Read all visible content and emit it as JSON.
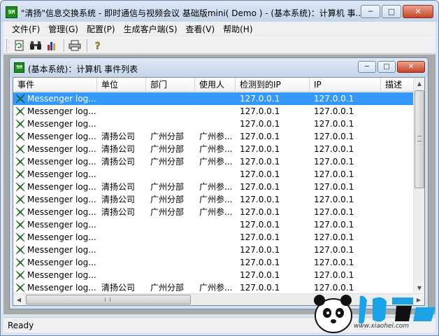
{
  "window": {
    "title": "\"清扬\"信息交换系统 - 即时通信与视频会议 基础版mini( Demo ) - (基本系统)：计算机 事...",
    "app_icon_text": "9M",
    "minimize": "─",
    "maximize": "□",
    "close": "✕"
  },
  "menu": {
    "items": [
      {
        "label": "文件(F)"
      },
      {
        "label": "管理(G)"
      },
      {
        "label": "配置(P)"
      },
      {
        "label": "生成客户端(S)"
      },
      {
        "label": "查看(V)"
      },
      {
        "label": "帮助(H)"
      }
    ]
  },
  "toolbar": {
    "tools": [
      "refresh-icon",
      "binoculars-icon",
      "bar-chart-icon",
      "print-icon",
      "help-icon"
    ]
  },
  "child_window": {
    "title": "(基本系统)：计算机 事件列表",
    "icon_text": "9M",
    "minimize": "─",
    "maximize": "□",
    "close": "✕"
  },
  "table": {
    "columns": [
      "事件",
      "单位",
      "部门",
      "使用人",
      "检测到的IP",
      "IP",
      "描述"
    ],
    "rows": [
      {
        "event": "Messenger log...",
        "unit": "",
        "dept": "",
        "user": "",
        "detected_ip": "127.0.0.1",
        "ip": "127.0.0.1",
        "desc": "",
        "selected": true
      },
      {
        "event": "Messenger log...",
        "unit": "",
        "dept": "",
        "user": "",
        "detected_ip": "127.0.0.1",
        "ip": "127.0.0.1",
        "desc": ""
      },
      {
        "event": "Messenger log...",
        "unit": "",
        "dept": "",
        "user": "",
        "detected_ip": "127.0.0.1",
        "ip": "127.0.0.1",
        "desc": ""
      },
      {
        "event": "Messenger log...",
        "unit": "清扬公司",
        "dept": "广州分部",
        "user": "广州参...",
        "detected_ip": "127.0.0.1",
        "ip": "127.0.0.1",
        "desc": ""
      },
      {
        "event": "Messenger log...",
        "unit": "清扬公司",
        "dept": "广州分部",
        "user": "广州参...",
        "detected_ip": "127.0.0.1",
        "ip": "127.0.0.1",
        "desc": ""
      },
      {
        "event": "Messenger log...",
        "unit": "清扬公司",
        "dept": "广州分部",
        "user": "广州参...",
        "detected_ip": "127.0.0.1",
        "ip": "127.0.0.1",
        "desc": ""
      },
      {
        "event": "Messenger log...",
        "unit": "",
        "dept": "",
        "user": "",
        "detected_ip": "127.0.0.1",
        "ip": "127.0.0.1",
        "desc": ""
      },
      {
        "event": "Messenger log...",
        "unit": "清扬公司",
        "dept": "广州分部",
        "user": "广州参...",
        "detected_ip": "127.0.0.1",
        "ip": "127.0.0.1",
        "desc": ""
      },
      {
        "event": "Messenger log...",
        "unit": "清扬公司",
        "dept": "广州分部",
        "user": "广州参...",
        "detected_ip": "127.0.0.1",
        "ip": "127.0.0.1",
        "desc": ""
      },
      {
        "event": "Messenger log...",
        "unit": "清扬公司",
        "dept": "广州分部",
        "user": "广州参...",
        "detected_ip": "127.0.0.1",
        "ip": "127.0.0.1",
        "desc": ""
      },
      {
        "event": "Messenger log...",
        "unit": "",
        "dept": "",
        "user": "",
        "detected_ip": "127.0.0.1",
        "ip": "127.0.0.1",
        "desc": ""
      },
      {
        "event": "Messenger log...",
        "unit": "",
        "dept": "",
        "user": "",
        "detected_ip": "127.0.0.1",
        "ip": "127.0.0.1",
        "desc": ""
      },
      {
        "event": "Messenger log...",
        "unit": "",
        "dept": "",
        "user": "",
        "detected_ip": "127.0.0.1",
        "ip": "127.0.0.1",
        "desc": ""
      },
      {
        "event": "Messenger log...",
        "unit": "",
        "dept": "",
        "user": "",
        "detected_ip": "127.0.0.1",
        "ip": "127.0.0.1",
        "desc": ""
      },
      {
        "event": "Messenger log...",
        "unit": "",
        "dept": "",
        "user": "",
        "detected_ip": "127.0.0.1",
        "ip": "127.0.0.1",
        "desc": ""
      },
      {
        "event": "Messenger log...",
        "unit": "清扬公司",
        "dept": "广州分部",
        "user": "广州参...",
        "detected_ip": "127.0.0.1",
        "ip": "127.0.0.1",
        "desc": ""
      }
    ]
  },
  "statusbar": {
    "text": "Ready"
  },
  "watermark": {
    "url": "www.xiaohei.com"
  },
  "colors": {
    "selection": "#3399ff",
    "event_icon": "#2a9a2a"
  }
}
